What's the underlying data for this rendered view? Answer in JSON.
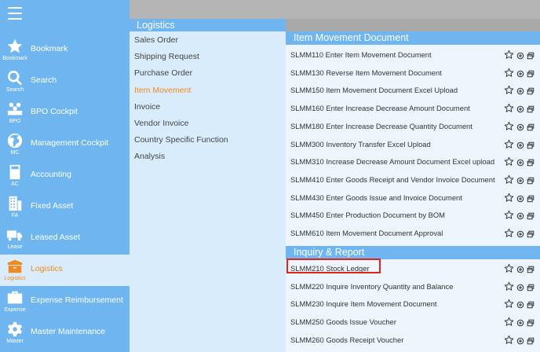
{
  "sidebar": {
    "items": [
      {
        "label": "Bookmark",
        "abbr": "Bookmark",
        "icon": "star-icon"
      },
      {
        "label": "Search",
        "abbr": "Search",
        "icon": "search-icon"
      },
      {
        "label": "BPO Cockpit",
        "abbr": "BPO",
        "icon": "people-icon"
      },
      {
        "label": "Management Cockpit",
        "abbr": "MC",
        "icon": "globe-icon"
      },
      {
        "label": "Accounting",
        "abbr": "AC",
        "icon": "calculator-icon"
      },
      {
        "label": "Fixed Asset",
        "abbr": "FA",
        "icon": "building-icon"
      },
      {
        "label": "Leased Asset",
        "abbr": "Lease",
        "icon": "truck-icon"
      },
      {
        "label": "Logistics",
        "abbr": "Logistics",
        "icon": "box-icon",
        "active": true
      },
      {
        "label": "Expense Reimbursement",
        "abbr": "Expense",
        "icon": "briefcase-icon"
      },
      {
        "label": "Master Maintenance",
        "abbr": "Master",
        "icon": "gear-icon"
      }
    ]
  },
  "middle": {
    "title": "Logistics",
    "items": [
      {
        "label": "Sales Order"
      },
      {
        "label": "Shipping Request"
      },
      {
        "label": "Purchase Order"
      },
      {
        "label": "Item Movement",
        "active": true
      },
      {
        "label": "Invoice"
      },
      {
        "label": "Vendor Invoice"
      },
      {
        "label": "Country Specific Function"
      },
      {
        "label": "Analysis"
      }
    ]
  },
  "right": {
    "sections": [
      {
        "title": "Item Movement Document",
        "rows": [
          "SLMM110 Enter Item Movement Document",
          "SLMM130 Reverse Item Movement Document",
          "SLMM150 Item Movement Document Excel Upload",
          "SLMM160 Enter Increase Decrease Amount Document",
          "SLMM180 Enter Increase Decrease Quantity Document",
          "SLMM300 Inventory Transfer Excel Upload",
          "SLMM310 Increase Decrease Amount Document Excel upload",
          "SLMM410 Enter Goods Receipt and Vendor Invoice Document",
          "SLMM430 Enter Goods Issue and Invoice Document",
          "SLMM450 Enter Production Document by BOM",
          "SLMM610 Item Movement Document Approval"
        ]
      },
      {
        "title": "Inquiry & Report",
        "rows": [
          "SLMM210 Stock Ledger",
          "SLMM220 Inquire Inventory Quantity and Balance",
          "SLMM230 Inquire Item Movement Document",
          "SLMM250 Goods Issue Voucher",
          "SLMM260 Goods Receipt Voucher"
        ]
      }
    ]
  },
  "colors": {
    "sidebar": "#6fb6f1",
    "active": "#f18a1e",
    "highlight": "#e0241b"
  }
}
